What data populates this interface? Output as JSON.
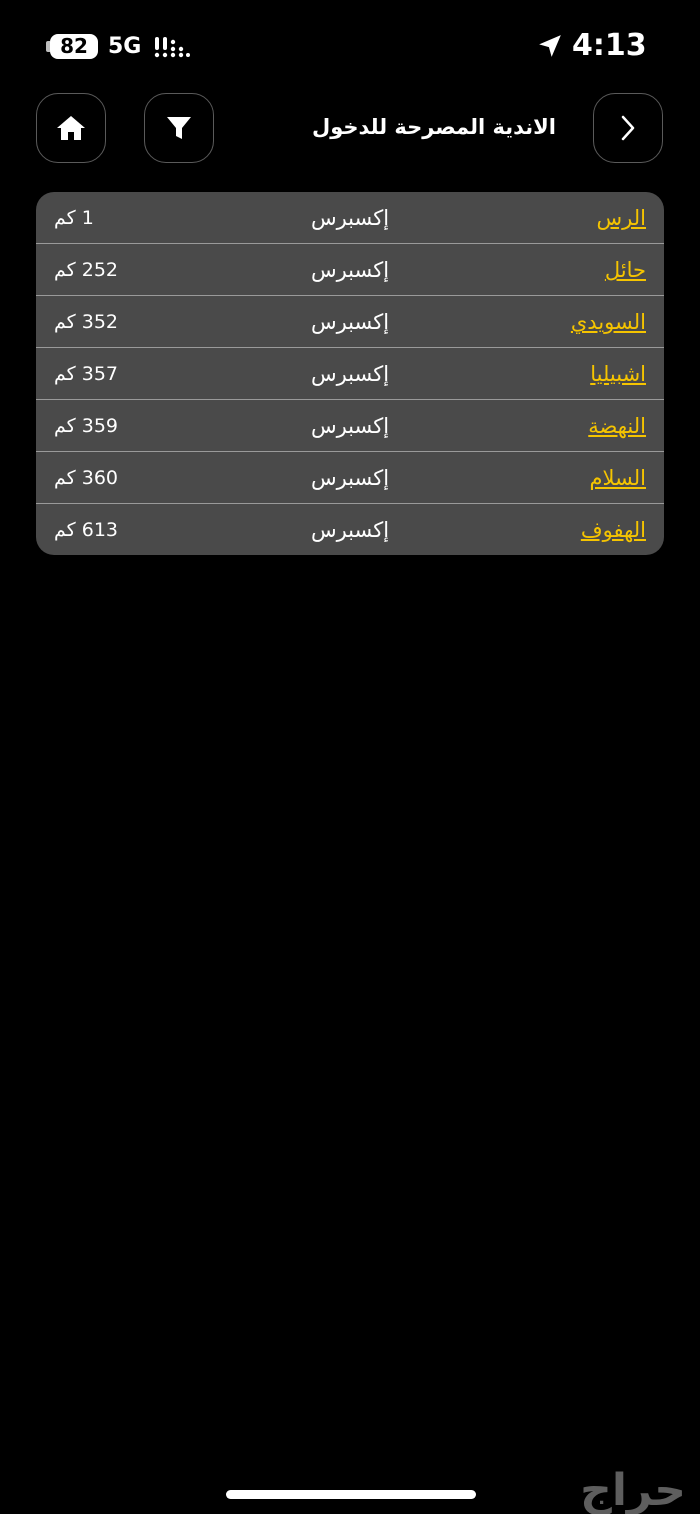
{
  "status_bar": {
    "battery": "82",
    "network": "5G",
    "time": "4:13"
  },
  "header": {
    "title": "الاندية المصرحة للدخول",
    "home_icon": "home-icon",
    "filter_icon": "filter-icon",
    "forward_icon": "chevron-right-icon"
  },
  "clubs": [
    {
      "name": "الرس",
      "type": "إكسبرس",
      "distance": "1 كم"
    },
    {
      "name": "حائل",
      "type": "إكسبرس",
      "distance": "252 كم"
    },
    {
      "name": "السويدي",
      "type": "إكسبرس",
      "distance": "352 كم"
    },
    {
      "name": "اشبيليا",
      "type": "إكسبرس",
      "distance": "357 كم"
    },
    {
      "name": "النهضة",
      "type": "إكسبرس",
      "distance": "359 كم"
    },
    {
      "name": "السلام",
      "type": "إكسبرس",
      "distance": "360 كم"
    },
    {
      "name": "الهفوف",
      "type": "إكسبرس",
      "distance": "613 كم"
    }
  ],
  "watermark": "حراج",
  "colors": {
    "background": "#000000",
    "card": "#4a4a4a",
    "link": "#f5c400",
    "text": "#ffffff"
  }
}
